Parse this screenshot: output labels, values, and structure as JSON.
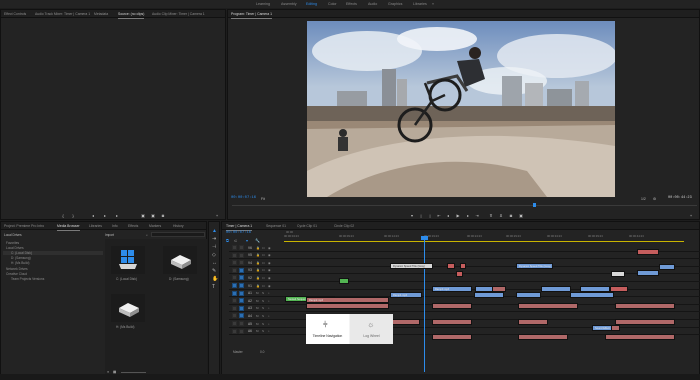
{
  "workspaces": [
    "Learning",
    "Assembly",
    "Editing",
    "Color",
    "Effects",
    "Audio",
    "Graphics",
    "Libraries"
  ],
  "active_workspace": "Editing",
  "source_panel": {
    "tabs": [
      "Effect Controls",
      "Audio Track Mixer: Timer | Camera 1",
      "Metadata",
      "Source: (no clips)",
      "Audio Clip Mixer: Timer | Camera 1"
    ]
  },
  "program_monitor": {
    "tab": "Program: Timer | Camera 1",
    "timecode_current": "00:00:07:16",
    "zoom": "Fit",
    "quality": "1/2",
    "timecode_duration": "00:00:44:23",
    "playhead_fraction": 0.16
  },
  "project_panel": {
    "tabs": [
      "Project: Premiere Pro Intro",
      "Media Browser",
      "Libraries",
      "Info",
      "Effects",
      "Markers",
      "History"
    ],
    "search_label": "Import",
    "tree": [
      "Local Drives",
      "Favorites",
      "Local Drives",
      "C: (Local Disk)",
      "D: (Samsung)",
      "H: (Ms Build)",
      "Network Drives",
      "Creative Cloud",
      "Team Projects Versions"
    ],
    "items": [
      {
        "label": "C: (Local Disk)"
      },
      {
        "label": "D: (Samsung)"
      },
      {
        "label": "H: (Ms Build)"
      }
    ]
  },
  "timeline": {
    "tabs": [
      "Timer | Camera 1",
      "Sequence 01",
      "Cycle Clip 01",
      "Circle Clip 02"
    ],
    "timecode": "00:00:07:16",
    "ruler_labels": [
      "00:00",
      "00:00:04:23",
      "00:00:09:23",
      "00:00:14:23",
      "00:00:19:23",
      "00:00:24:23",
      "00:00:29:23",
      "00:00:34:23",
      "00:00:39:23",
      "00:00:44:23"
    ],
    "tracks": [
      "V6",
      "V5",
      "V4",
      "V3",
      "V2",
      "V1",
      "A1",
      "A2",
      "A3",
      "A4",
      "A5",
      "A6",
      "Master"
    ],
    "master_value": "0.0",
    "clip_labels": {
      "title": "Dynamic Speed Title (Gray)",
      "v2": "Ramp4.mp4",
      "v3": "Ramp3.mp4",
      "v1": "Ramp2.mp4",
      "audio": "Sound Effect 1.wav",
      "green": "Nested Sequence 01"
    }
  },
  "tooltip": {
    "left": "Timeline Navigation",
    "right": "Log Wheel"
  },
  "colors": {
    "accent": "#2d8ceb",
    "video_clip": "#6f9ad6",
    "audio_clip": "#b06868",
    "green_clip": "#53b553"
  }
}
